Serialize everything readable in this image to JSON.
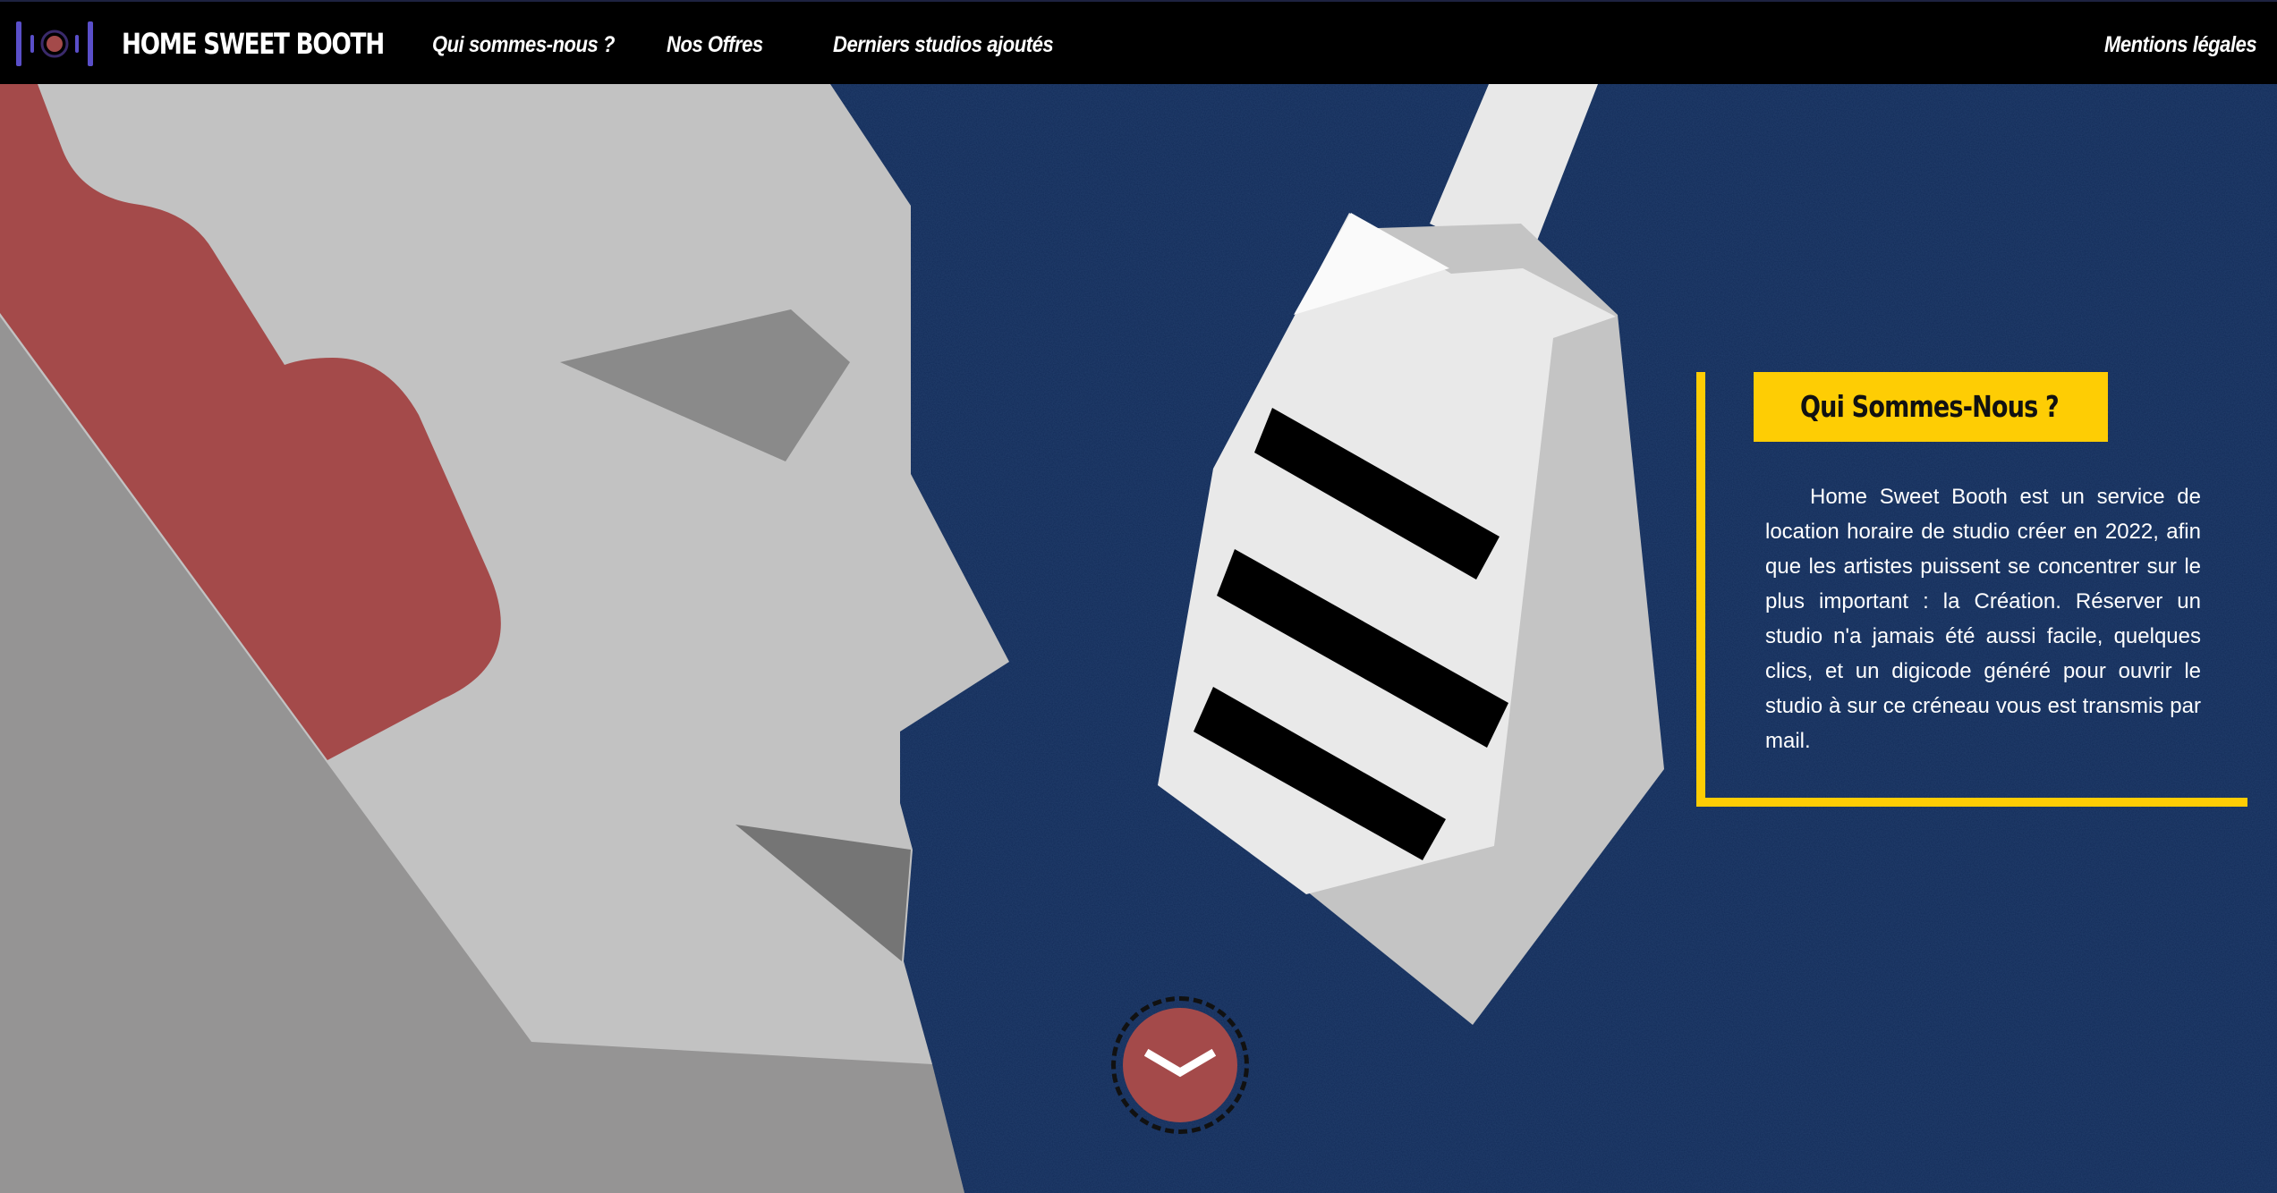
{
  "header": {
    "brand": "HOME SWEET BOOTH",
    "logo_icon": "sound-record-icon",
    "nav": {
      "about": "Qui sommes-nous ?",
      "offers": "Nos Offres",
      "latest": "Derniers studios ajoutés",
      "legal": "Mentions légales"
    }
  },
  "about_panel": {
    "title": "Qui Sommes-Nous ?",
    "text": "Home Sweet Booth est un service de location horaire de studio créer en 2022, afin que les artistes puissent se concentrer sur le plus important : la Création. Réserver un studio n'a jamais été aussi facile, quelques clics, et un digicode généré pour ouvrir le studio à sur ce créneau vous est transmis par mail."
  },
  "scroll_button": {
    "icon": "chevron-down-icon"
  },
  "colors": {
    "background": "#132c59",
    "navbar": "#000000",
    "accent_yellow": "#fecd04",
    "accent_red": "#a44a4a",
    "logo_purple": "#5a4fc9"
  }
}
